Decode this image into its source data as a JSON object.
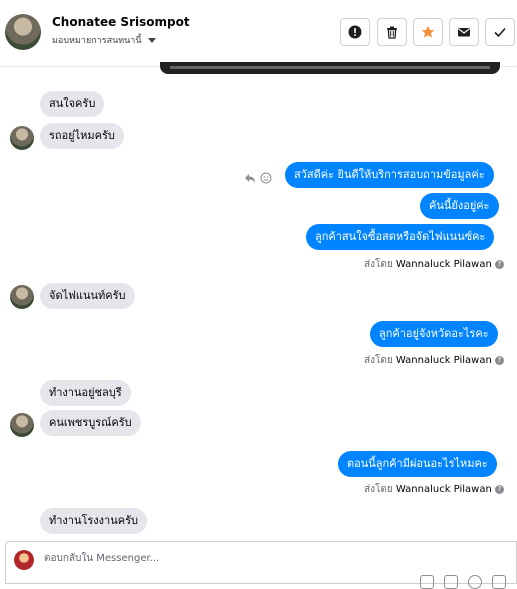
{
  "header": {
    "contact_name": "Chonatee Srisompot",
    "assign_label": "มอบหมายการสนทนานี้",
    "buttons": [
      {
        "name": "mark-spam",
        "icon": "exclamation-icon"
      },
      {
        "name": "delete",
        "icon": "trash-icon"
      },
      {
        "name": "star",
        "icon": "star-icon"
      },
      {
        "name": "mark-unread",
        "icon": "envelope-icon"
      },
      {
        "name": "mark-done",
        "icon": "checkmark-icon"
      }
    ],
    "star_color": "#f7923a"
  },
  "messages": {
    "m1": "สนใจครับ",
    "m2": "รถอยู่ไหมครับ",
    "m3": "สวัสดีค่ะ  ยินดีให้บริการสอบถามข้อมูลค่ะ",
    "m4": "คันนี้ยังอยู่ค่ะ",
    "m5": "ลูกค้าสนใจซื้อสดหรือจัดไฟแนนซ์คะ",
    "sent1_prefix": "ส่งโดย",
    "sent1_name": "Wannaluck Pilawan",
    "m6": "จัดไฟแนนท์ครับ",
    "m7": "ลูกค้าอยู่จังหวัดอะไรคะ",
    "sent2_prefix": "ส่งโดย",
    "sent2_name": "Wannaluck Pilawan",
    "m8": "ทำงานอยู่ชลบุรี",
    "m9": "คนเพชรบูรณ์ครับ",
    "m10": "ตอนนี้ลูกค้ามีผ่อนอะไรไหมคะ",
    "sent3_prefix": "ส่งโดย",
    "sent3_name": "Wannaluck Pilawan",
    "m11": "ทำงานโรงงานครับ"
  },
  "composer": {
    "placeholder": "ตอบกลับใน Messenger..."
  },
  "colors": {
    "outgoing_bubble": "#0084ff",
    "incoming_bubble": "#e4e6eb"
  }
}
